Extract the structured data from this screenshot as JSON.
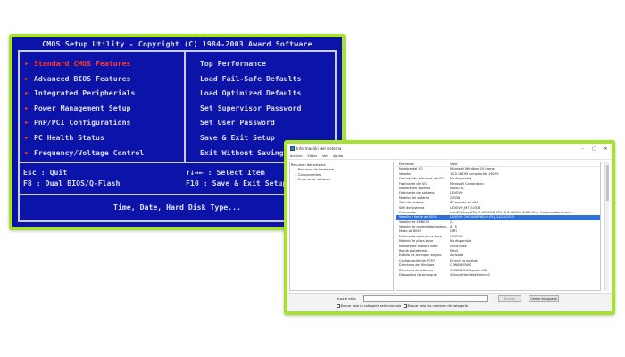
{
  "bios": {
    "title": "CMOS Setup Utility - Copyright (C) 1984-2003 Award Software",
    "left_menu": [
      {
        "label": "Standard CMOS Features",
        "selected": true
      },
      {
        "label": "Advanced BIOS Features",
        "selected": false
      },
      {
        "label": "Integrated Peripherials",
        "selected": false
      },
      {
        "label": "Power Management Setup",
        "selected": false
      },
      {
        "label": "PnP/PCI Configurations",
        "selected": false
      },
      {
        "label": "PC Health Status",
        "selected": false
      },
      {
        "label": "Frequency/Voltage Control",
        "selected": false
      }
    ],
    "right_menu": [
      {
        "label": "Top Performance"
      },
      {
        "label": "Load Fail-Safe Defaults"
      },
      {
        "label": "Load Optimized Defaults"
      },
      {
        "label": "Set Supervisor Password"
      },
      {
        "label": "Set User Password"
      },
      {
        "label": "Save & Exit Setup"
      },
      {
        "label": "Exit Without Saving"
      }
    ],
    "keys": {
      "esc": "Esc  : Quit",
      "f8": "F8   : Dual BIOS/Q-Flash",
      "arrows": "↑↓→← : Select Item",
      "f10": "F10 : Save & Exit Setup"
    },
    "help": "Time, Date, Hard Disk Type...",
    "colors": {
      "background": "#0b13a8",
      "frame": "#a6e22e",
      "highlight": "#ff3b2a"
    }
  },
  "sysinfo": {
    "title": "Información del sistema",
    "menu": [
      "Archivo",
      "Editar",
      "Ver",
      "Ayuda"
    ],
    "tree": [
      {
        "label": "Resumen del sistema",
        "level": 0,
        "twisty": ""
      },
      {
        "label": "Recursos de hardware",
        "level": 1,
        "twisty": "+"
      },
      {
        "label": "Componentes",
        "level": 1,
        "twisty": "+"
      },
      {
        "label": "Entorno de software",
        "level": 1,
        "twisty": "+"
      }
    ],
    "columns": [
      "Elemento",
      "Valor"
    ],
    "rows": [
      [
        "Nombre del SO",
        "Microsoft Windows 10 Home"
      ],
      [
        "Versión",
        "10.0.16299 compilación 16299"
      ],
      [
        "Descripción adicional del SO",
        "No disponible"
      ],
      [
        "Fabricante del SO",
        "Microsoft Corporation"
      ],
      [
        "Nombre del sistema",
        "MANU-PC"
      ],
      [
        "Fabricante del sistema",
        "LENOVO"
      ],
      [
        "Modelo del sistema",
        "20338"
      ],
      [
        "Tipo de sistema",
        "PC basado en x64"
      ],
      [
        "SKU del sistema",
        "LENOVO_MT_20338"
      ],
      [
        "Procesador",
        "Intel(R) Core(TM) i7-4700MQ CPU @ 2.40GHz, 2401 Mhz, 4 procesadores prin..."
      ],
      [
        "Versión y fecha de BIOS",
        "LENOVO 7HCN40WW(V2.05), 24/11/2015"
      ],
      [
        "Versión de SMBIOS",
        "2.7"
      ],
      [
        "Versión de controladora integ...",
        "0.15"
      ],
      [
        "Modo de BIOS",
        "UEFI"
      ],
      [
        "Fabricante de la placa base",
        "LENOVO"
      ],
      [
        "Modelo de placa base",
        "No disponible"
      ],
      [
        "Nombre de la placa base",
        "Placa base"
      ],
      [
        "Rol de plataforma",
        "Móvil"
      ],
      [
        "Estado de arranque seguro",
        "Activado"
      ],
      [
        "Configuración de PCR7",
        "Enlace no posible"
      ],
      [
        "Directorio de Windows",
        "C:\\WINDOWS"
      ],
      [
        "Directorio del sistema",
        "C:\\WINDOWS\\system32"
      ],
      [
        "Dispositivo de arranque",
        "\\Device\\HarddiskVolume2"
      ]
    ],
    "selected_row": 10,
    "find": {
      "label": "Buscar esto:",
      "value": "",
      "find_button": "Buscar",
      "close_button": "Cerrar búsqueda",
      "option_selected_category": "Buscar solo la categoría seleccionada",
      "option_category_names": "Buscar solo los nombres de categoría"
    }
  }
}
